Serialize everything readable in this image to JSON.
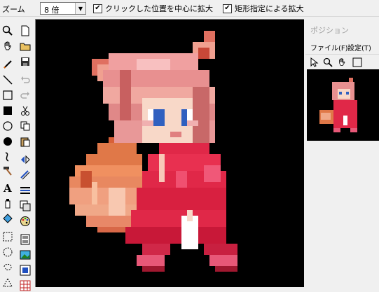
{
  "zoombar": {
    "zoom_label": "ズーム",
    "zoom_value": "8 倍",
    "center_on_click_label": "クリックした位置を中心に拡大",
    "center_on_click_checked": true,
    "rect_zoom_label": "矩形指定による拡大",
    "rect_zoom_checked": true
  },
  "toolbox": {
    "left_column": [
      "zoom-icon",
      "hand-icon",
      "pencil-icon",
      "line-icon",
      "rectangle-icon",
      "filled-rectangle-icon",
      "ellipse-icon",
      "filled-ellipse-icon",
      "curve-icon",
      "hammer-icon",
      "text-icon",
      "spray-icon",
      "fill-bucket-icon",
      "rect-select-icon",
      "ellipse-select-icon",
      "lasso-select-icon",
      "polygon-select-icon"
    ],
    "right_column": [
      "new-file-icon",
      "open-folder-icon",
      "save-icon",
      "undo-icon",
      "redo-icon",
      "cut-icon",
      "copy-icon",
      "paste-icon",
      "flip-icon",
      "rotate-icon",
      "stripes-icon",
      "layers-icon",
      "palette-icon",
      "film-icon",
      "picture-icon",
      "frame-icon",
      "grid-icon"
    ]
  },
  "panel": {
    "title": "ポジション",
    "menu_file": "ファイル(F)",
    "menu_settings": "設定(T)",
    "tools": [
      "pointer-icon",
      "zoom-icon",
      "hand-icon",
      "rectangle-icon"
    ]
  },
  "colors": {
    "canvas_bg": "#000000",
    "hair_light": "#f0a0a0",
    "hair_mid": "#e07070",
    "dress": "#e02848",
    "tail_orange": "#e07848",
    "skin": "#f8d8c8",
    "eyes": "#3060c0"
  }
}
